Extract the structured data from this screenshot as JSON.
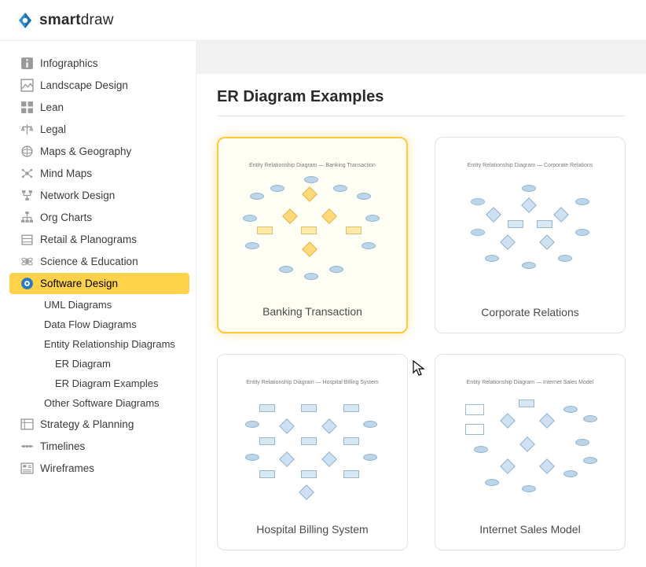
{
  "brand": {
    "name_bold": "smart",
    "name_light": "draw"
  },
  "sidebar": {
    "items": [
      {
        "label": "Infographics",
        "icon": "info"
      },
      {
        "label": "Landscape Design",
        "icon": "landscape"
      },
      {
        "label": "Lean",
        "icon": "grid"
      },
      {
        "label": "Legal",
        "icon": "scales"
      },
      {
        "label": "Maps & Geography",
        "icon": "globe"
      },
      {
        "label": "Mind Maps",
        "icon": "mindmap"
      },
      {
        "label": "Network Design",
        "icon": "network"
      },
      {
        "label": "Org Charts",
        "icon": "orgchart"
      },
      {
        "label": "Retail & Planograms",
        "icon": "retail"
      },
      {
        "label": "Science & Education",
        "icon": "science"
      },
      {
        "label": "Software Design",
        "icon": "software",
        "active": true
      },
      {
        "label": "Strategy & Planning",
        "icon": "strategy"
      },
      {
        "label": "Timelines",
        "icon": "timeline"
      },
      {
        "label": "Wireframes",
        "icon": "wireframe"
      }
    ],
    "software_children": [
      {
        "label": "UML Diagrams"
      },
      {
        "label": "Data Flow Diagrams"
      },
      {
        "label": "Entity Relationship Diagrams"
      },
      {
        "label": "Other Software Diagrams"
      }
    ],
    "erd_children": [
      {
        "label": "ER Diagram"
      },
      {
        "label": "ER Diagram Examples"
      }
    ]
  },
  "page": {
    "title": "ER Diagram Examples"
  },
  "templates": [
    {
      "label": "Banking Transaction",
      "preview_title": "Entity Relationship Diagram — Banking Transaction",
      "selected": true
    },
    {
      "label": "Corporate Relations",
      "preview_title": "Entity Relationship Diagram — Corporate Relations",
      "selected": false
    },
    {
      "label": "Hospital Billing System",
      "preview_title": "Entity Relationship Diagram — Hospital Billing System",
      "selected": false
    },
    {
      "label": "Internet Sales Model",
      "preview_title": "Entity Relationship Diagram — Internet Sales Model",
      "selected": false
    }
  ]
}
